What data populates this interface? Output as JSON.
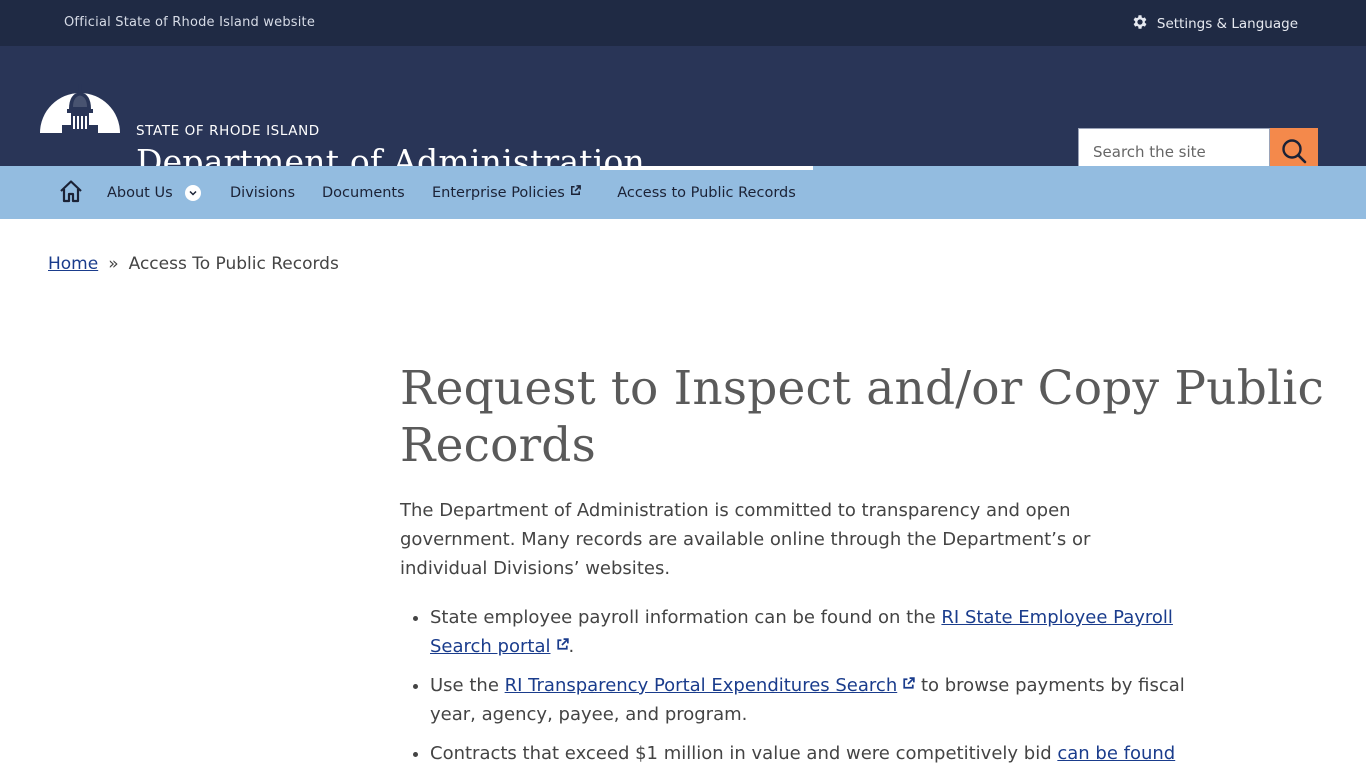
{
  "topbar": {
    "official_text": "Official State of Rhode Island website",
    "settings_label": "Settings & Language"
  },
  "header": {
    "state_name": "STATE OF RHODE ISLAND",
    "dept_name": "Department of Administration",
    "search_placeholder": "Search the site"
  },
  "nav": {
    "items": [
      {
        "label": "About Us"
      },
      {
        "label": "Divisions"
      },
      {
        "label": "Documents"
      },
      {
        "label": "Enterprise Policies"
      },
      {
        "label": "Access to Public Records"
      }
    ]
  },
  "breadcrumb": {
    "home": "Home",
    "separator": "»",
    "current": "Access To Public Records"
  },
  "main": {
    "title": "Request to Inspect and/or Copy Public Records",
    "intro": "The Department of Administration is committed to transparency and open government. Many records are available online through the Department’s or individual Divisions’ websites.",
    "bullets": [
      {
        "pre": "State employee payroll information can be found on the ",
        "link": "RI State Employee Payroll Search portal",
        "post": "."
      },
      {
        "pre": "Use the ",
        "link": "RI Transparency Portal Expenditures Search",
        "post": " to browse payments by fiscal year, agency, payee, and program."
      },
      {
        "pre": "Contracts that exceed $1 million in value and were competitively bid ",
        "link": "can be found",
        "post": ""
      }
    ]
  },
  "colors": {
    "topbar_bg": "#1f2a44",
    "header_bg": "#293557",
    "nav_bg": "#93bce0",
    "search_button": "#f4894b",
    "link": "#1a3c8c"
  }
}
